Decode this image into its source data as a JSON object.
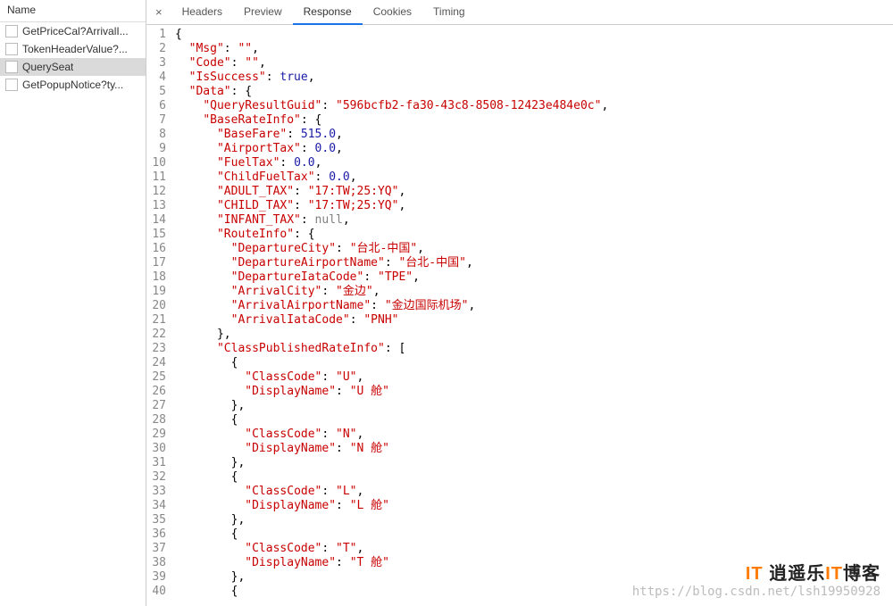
{
  "sidebar": {
    "header": "Name",
    "items": [
      {
        "label": "GetPriceCal?ArrivalI..."
      },
      {
        "label": "TokenHeaderValue?..."
      },
      {
        "label": "QuerySeat"
      },
      {
        "label": "GetPopupNotice?ty..."
      }
    ],
    "selectedIndex": 2
  },
  "tabs": {
    "close": "×",
    "items": [
      "Headers",
      "Preview",
      "Response",
      "Cookies",
      "Timing"
    ],
    "activeIndex": 2
  },
  "json_response": {
    "Msg": "",
    "Code": "",
    "IsSuccess": true,
    "Data": {
      "QueryResultGuid": "596bcfb2-fa30-43c8-8508-12423e484e0c",
      "BaseRateInfo": {
        "BaseFare": 515.0,
        "AirportTax": 0.0,
        "FuelTax": 0.0,
        "ChildFuelTax": 0.0,
        "ADULT_TAX": "17:TW;25:YQ",
        "CHILD_TAX": "17:TW;25:YQ",
        "INFANT_TAX": null,
        "RouteInfo": {
          "DepartureCity": "台北-中国",
          "DepartureAirportName": "台北-中国",
          "DepartureIataCode": "TPE",
          "ArrivalCity": "金边",
          "ArrivalAirportName": "金边国际机场",
          "ArrivalIataCode": "PNH"
        },
        "ClassPublishedRateInfo": [
          {
            "ClassCode": "U",
            "DisplayName": "U 舱"
          },
          {
            "ClassCode": "N",
            "DisplayName": "N 舱"
          },
          {
            "ClassCode": "L",
            "DisplayName": "L 舱"
          },
          {
            "ClassCode": "T",
            "DisplayName": "T 舱"
          }
        ]
      }
    }
  },
  "watermark": {
    "logo_part1": "IT",
    "logo_part2": "逍遥乐",
    "logo_part3": "博客",
    "url": "https://blog.csdn.net/lsh19950928"
  }
}
